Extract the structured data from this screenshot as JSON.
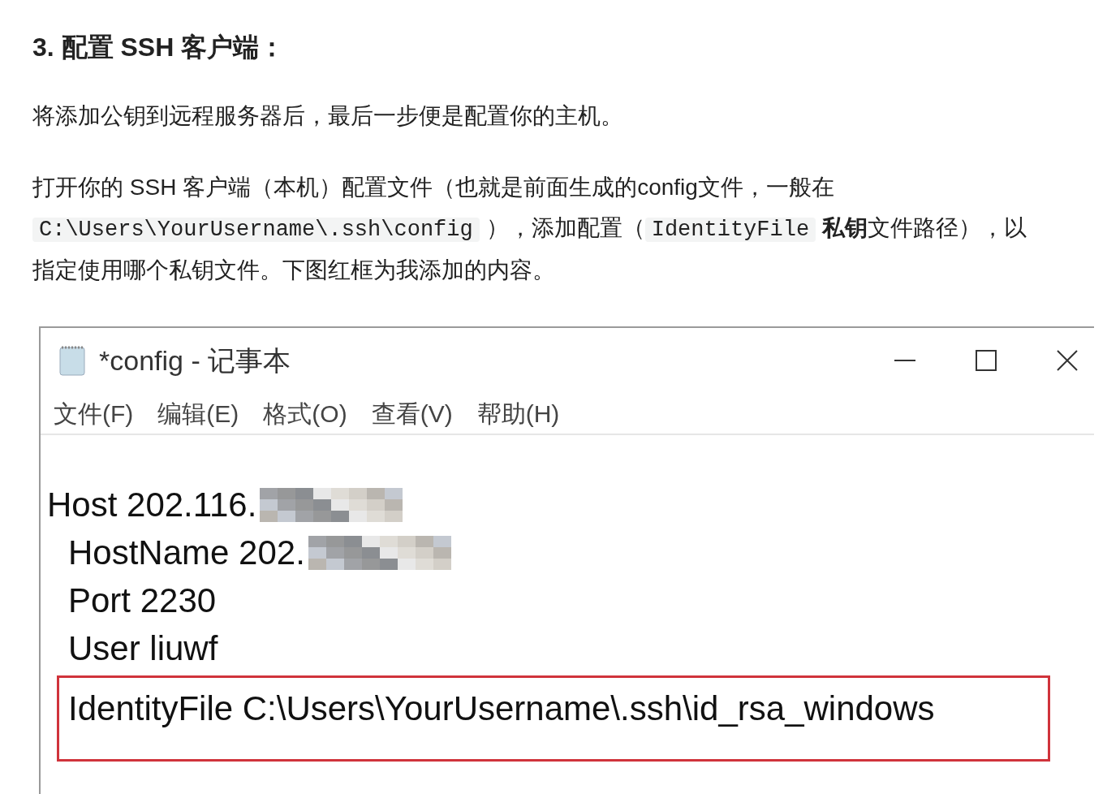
{
  "heading": "3. 配置 SSH 客户端：",
  "paragraphs": [
    [
      {
        "kind": "text",
        "text": "将添加公钥到远程服务器后，最后一步便是配置你的主机。"
      }
    ],
    [
      {
        "kind": "text",
        "text": "打开你的 SSH 客户端（本机）配置文件（也就是前面生成的config文件，一般在 "
      },
      {
        "kind": "code",
        "text": "C:\\Users\\YourUsername\\.ssh\\config"
      },
      {
        "kind": "text",
        "text": "），添加配置（"
      },
      {
        "kind": "code",
        "text": "IdentityFile"
      },
      {
        "kind": "bold",
        "text": "私钥"
      },
      {
        "kind": "text",
        "text": "文件路径），以指定使用哪个私钥文件。下图红框为我添加的内容。"
      }
    ]
  ],
  "notepad": {
    "title": "*config - 记事本",
    "menu": [
      "文件(F)",
      "编辑(E)",
      "格式(O)",
      "查看(V)",
      "帮助(H)"
    ],
    "lines": [
      {
        "text": "Host 202.116.",
        "indented": false,
        "redacted": true,
        "highlighted": false
      },
      {
        "text": "HostName 202.",
        "indented": true,
        "redacted": true,
        "highlighted": false
      },
      {
        "text": "Port 2230",
        "indented": true,
        "redacted": false,
        "highlighted": false
      },
      {
        "text": "User liuwf",
        "indented": true,
        "redacted": false,
        "highlighted": false
      },
      {
        "text": "IdentityFile C:\\Users\\YourUsername\\.ssh\\id_rsa_windows",
        "indented": true,
        "redacted": false,
        "highlighted": true
      }
    ]
  }
}
